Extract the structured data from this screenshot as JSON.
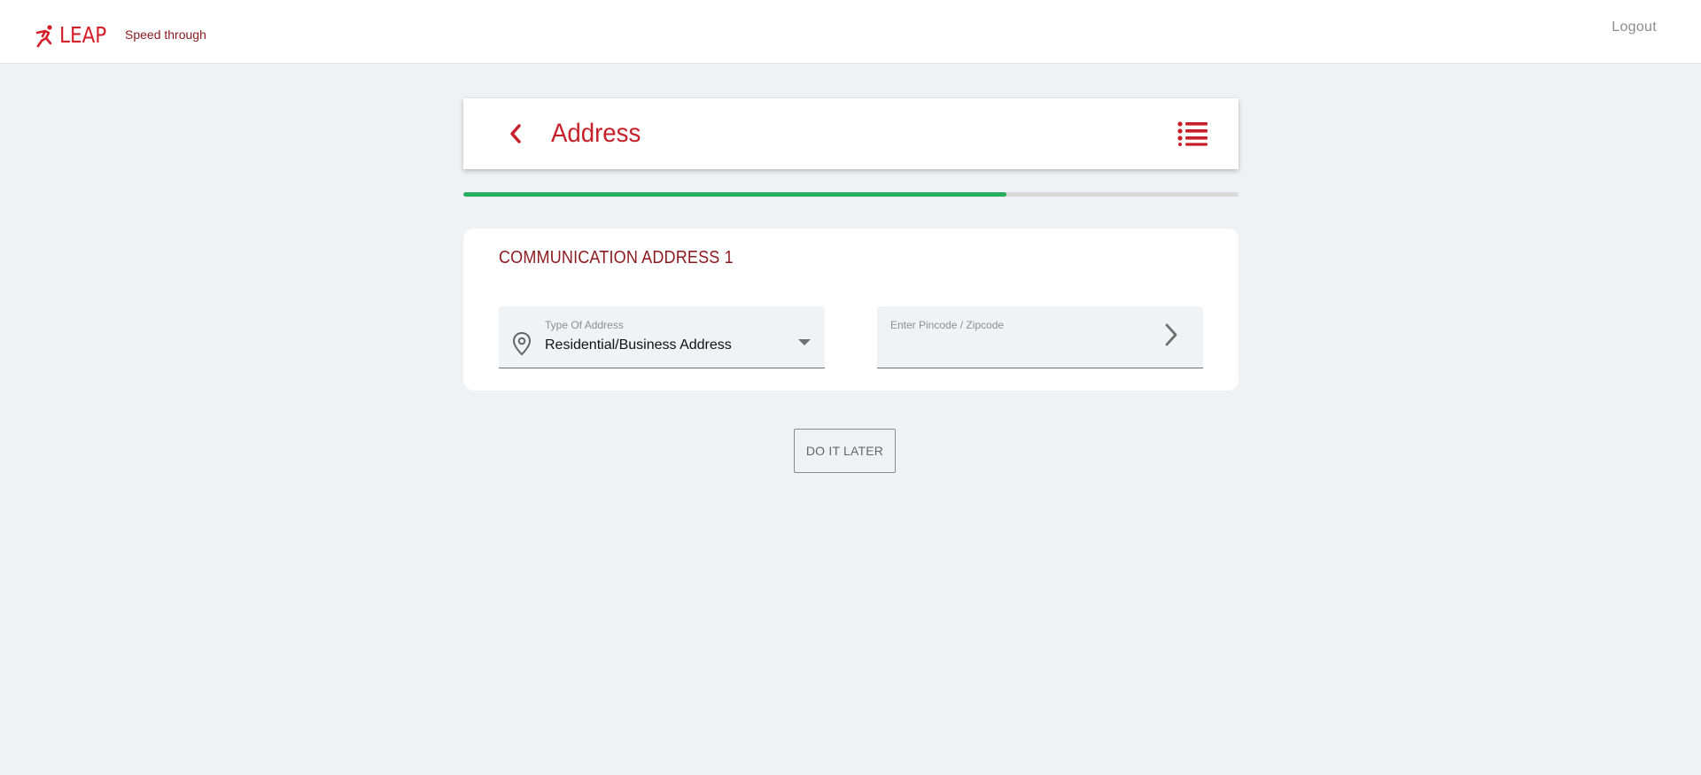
{
  "brand": {
    "name": "LEAP",
    "tagline": "Speed through",
    "logo_icon": "running-man-icon"
  },
  "topbar": {
    "logout_label": "Logout"
  },
  "header": {
    "title": "Address",
    "back_icon": "chevron-left-icon",
    "menu_icon": "list-menu-icon"
  },
  "progress": {
    "percent": 70
  },
  "section": {
    "title": "COMMUNICATION ADDRESS 1",
    "address_type": {
      "label": "Type Of Address",
      "value": "Residential/Business Address",
      "icon": "location-pin-icon"
    },
    "pincode": {
      "label": "Enter Pincode / Zipcode",
      "value": "",
      "next_icon": "chevron-right-icon"
    }
  },
  "actions": {
    "later_label": "DO IT LATER"
  },
  "colors": {
    "brand_red": "#d41f2a",
    "title_red": "#c8202a",
    "section_red": "#8c1a1f",
    "progress_green": "#27ae60",
    "background": "#f0f1f5"
  }
}
